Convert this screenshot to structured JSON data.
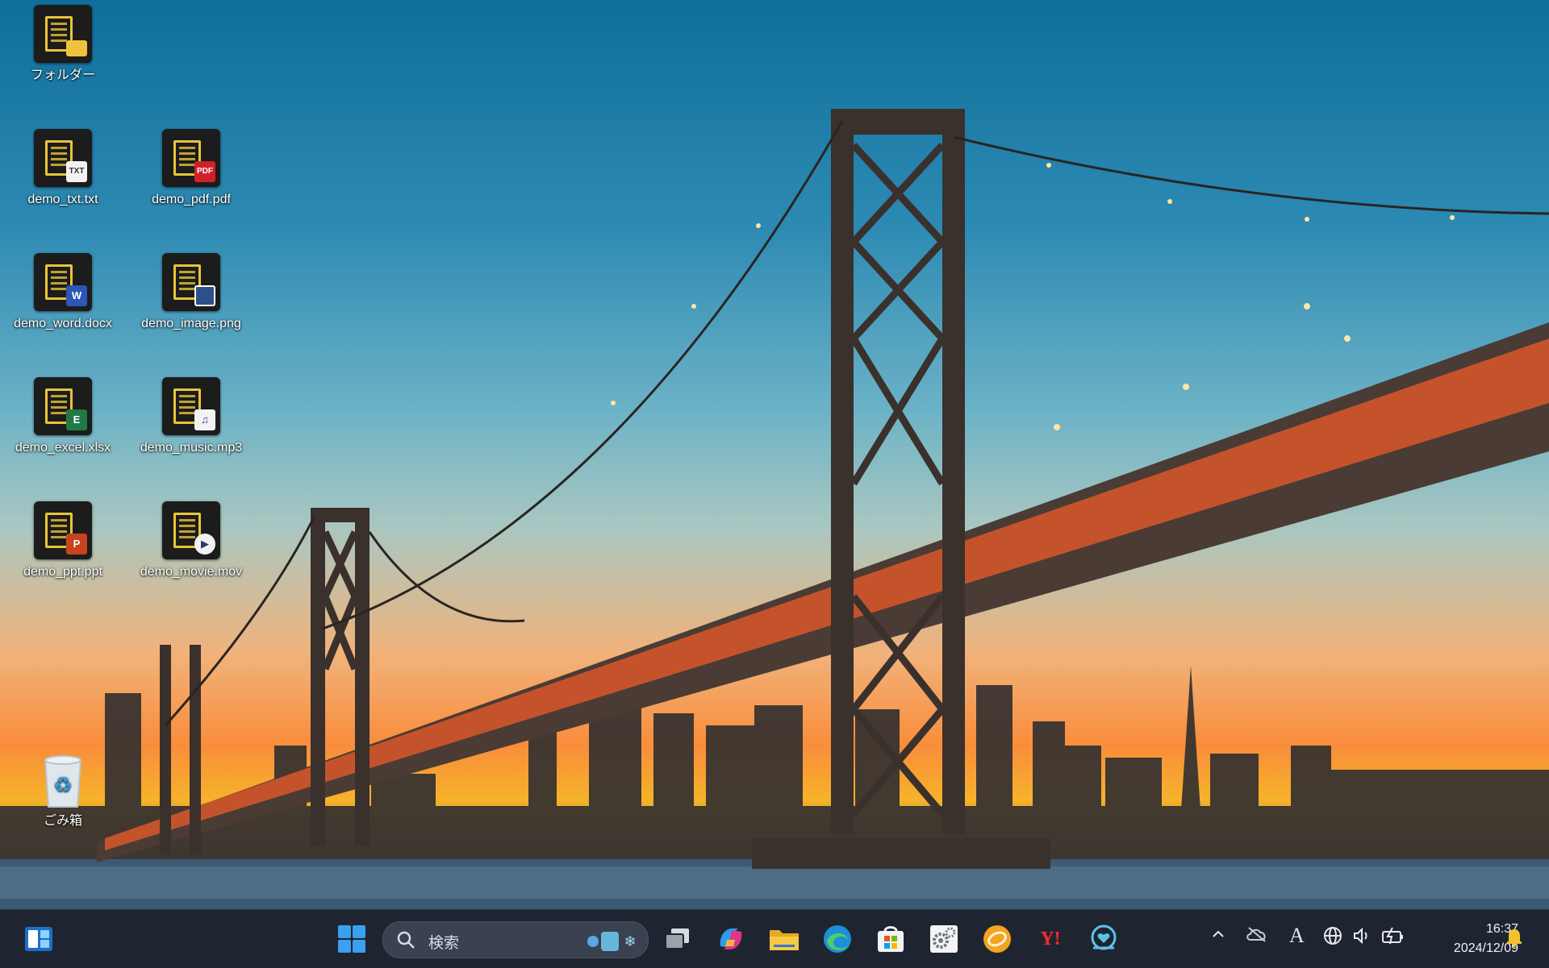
{
  "desktop": {
    "icons": [
      {
        "label": "フォルダー",
        "badge": ""
      },
      {
        "label": "demo_txt.txt",
        "badge": "TXT"
      },
      {
        "label": "demo_pdf.pdf",
        "badge": "PDF"
      },
      {
        "label": "demo_word.docx",
        "badge": "W"
      },
      {
        "label": "demo_image.png",
        "badge": ""
      },
      {
        "label": "demo_excel.xlsx",
        "badge": "E"
      },
      {
        "label": "demo_music.mp3",
        "badge": "♫"
      },
      {
        "label": "demo_ppt.ppt",
        "badge": "P"
      },
      {
        "label": "demo_movie.mov",
        "badge": "▶"
      },
      {
        "label": "ごみ箱",
        "badge": ""
      }
    ]
  },
  "taskbar": {
    "search_placeholder": "検索",
    "apps": [
      "widgets-icon",
      "start-icon",
      "task-view-icon",
      "copilot-icon",
      "file-explorer-icon",
      "edge-icon",
      "store-icon",
      "settings-icon",
      "orange-app-icon",
      "yahoo-icon",
      "support-app-icon"
    ],
    "yahoo_label": "Y!",
    "tray": {
      "ime_label": "A"
    },
    "clock": {
      "time": "16:37",
      "date": "2024/12/09"
    }
  },
  "colors": {
    "taskbar": "#1f2530",
    "icon_accent": "#e8c437",
    "pdf_badge": "#d0202a",
    "word_badge": "#2b57b7",
    "excel_badge": "#1f7a46",
    "ppt_badge": "#c8441f",
    "windows_blue": "#3aa0f0"
  }
}
